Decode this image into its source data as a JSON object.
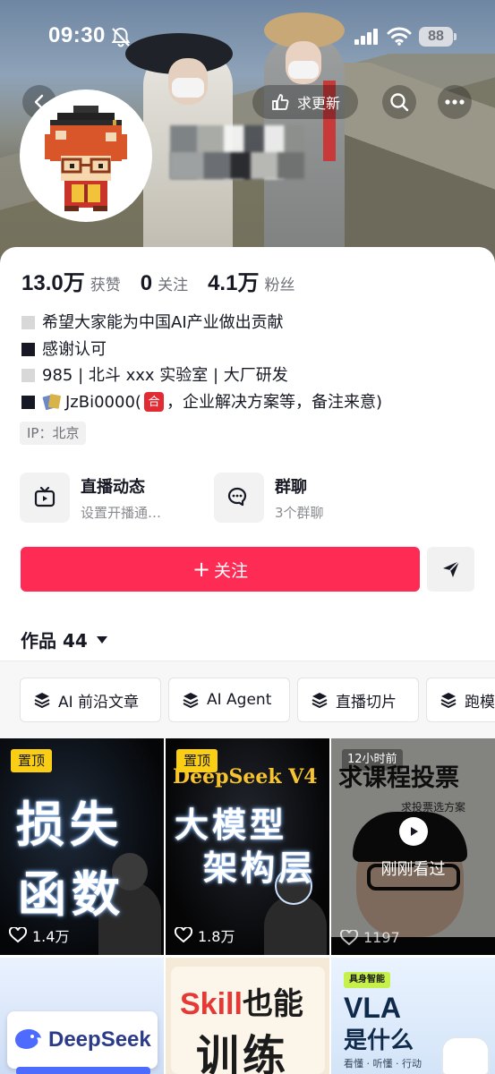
{
  "status_bar": {
    "time": "09:30",
    "battery": "88"
  },
  "header": {
    "update_request_label": "求更新"
  },
  "stats": [
    {
      "value": "13.0万",
      "label": "获赞"
    },
    {
      "value": "0",
      "label": "关注"
    },
    {
      "value": "4.1万",
      "label": "粉丝"
    }
  ],
  "bio": {
    "line1": "希望大家能为中国AI产业做出贡献",
    "line2": "感谢认可",
    "line3": "985 | 北斗 xxx 实验室 | 大厂研发",
    "line4_id": "JzBi0000",
    "line4_open": " (",
    "line4_badge": "合",
    "line4_rest": "，企业解决方案等，备注来意)"
  },
  "ip_location": "IP：北京",
  "features": {
    "live": {
      "title": "直播动态",
      "subtitle": "设置开播通…"
    },
    "group": {
      "title": "群聊",
      "subtitle": "3个群聊"
    }
  },
  "follow_button": {
    "icon": "+",
    "label": "关注"
  },
  "works_tab": {
    "label": "作品 44"
  },
  "collections": [
    "AI 前沿文章",
    "AI Agent",
    "直播切片",
    "跑模"
  ],
  "videos": [
    {
      "pinned": "置顶",
      "title_l1": "损失",
      "title_l2": "函数",
      "likes": "1.4万"
    },
    {
      "pinned": "置顶",
      "title_top": "DeepSeek V4",
      "title_l1": "大模型",
      "title_l2": "架构层",
      "likes": "1.8万"
    },
    {
      "time_tag": "12小时前",
      "title": "求课程投票",
      "subtitle": "求投票选方案",
      "viewed_label": "刚刚看过",
      "likes": "1197"
    },
    {
      "title": "DeepSeek"
    },
    {
      "title_red": "Skill",
      "title_rest": "也能",
      "title_l2": "训练"
    },
    {
      "tag": "具身智能",
      "title_l1": "VLA",
      "title_l2": "是什么",
      "subtitle": "看懂 · 听懂 · 行动"
    }
  ]
}
